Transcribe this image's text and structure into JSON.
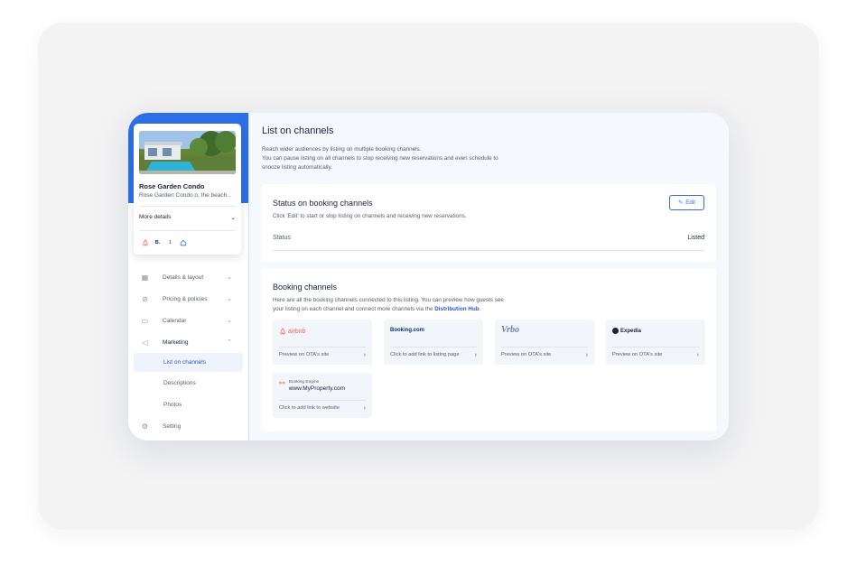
{
  "property": {
    "title": "Rose Garden Condo",
    "subtitle": "Rose Garden Condo o, the beach...",
    "more_details": "More details",
    "channel_badges": [
      "airbnb-icon",
      "B.",
      "1",
      "home-icon"
    ]
  },
  "nav": {
    "items": [
      {
        "label": "Details & layout",
        "icon": "grid-icon"
      },
      {
        "label": "Pricing & policies",
        "icon": "tag-icon"
      },
      {
        "label": "Calendar",
        "icon": "calendar-icon"
      },
      {
        "label": "Marketing",
        "icon": "megaphone-icon"
      }
    ],
    "subitems": [
      {
        "label": "List on channels",
        "active": true
      },
      {
        "label": "Descriptions"
      },
      {
        "label": "Photos"
      }
    ],
    "setting": "Setting"
  },
  "page": {
    "title": "List on channels",
    "desc1": "Reach wider audiences by listing on multiple booking channels.",
    "desc2": "You can pause listing on all channels to stop receiving new reservations and even schedule to",
    "desc3": "snooze listing automatically."
  },
  "status_panel": {
    "title": "Status on booking channels",
    "sub": "Click 'Edit' to start or stop listing on channels and receiving new reservations.",
    "edit": "Edit",
    "status_label": "Status",
    "status_value": "Listed"
  },
  "channels_panel": {
    "title": "Booking channels",
    "sub1": "Here are all the booking channels connected to this listing. You can preview how guests see",
    "sub2": "your listing on each channel and connect more channels via the",
    "link": "Distribution Hub",
    "period": ".",
    "cards": [
      {
        "logo": "airbnb",
        "foot": "Preview on OTA's site"
      },
      {
        "logo": "Booking.com",
        "foot": "Click to add link to listing page"
      },
      {
        "logo": "Vrbo",
        "foot": "Preview on OTA's site"
      },
      {
        "logo": "Expedia",
        "foot": "Preview on OTA's site"
      }
    ],
    "engine": {
      "label": "Booking Engine",
      "url": "www.MyProperty.com",
      "foot": "Click to add link to website"
    }
  },
  "colors": {
    "accent": "#2d6fe8",
    "airbnb": "#ff5a5f",
    "booking": "#003580",
    "text": "#1a2340"
  }
}
